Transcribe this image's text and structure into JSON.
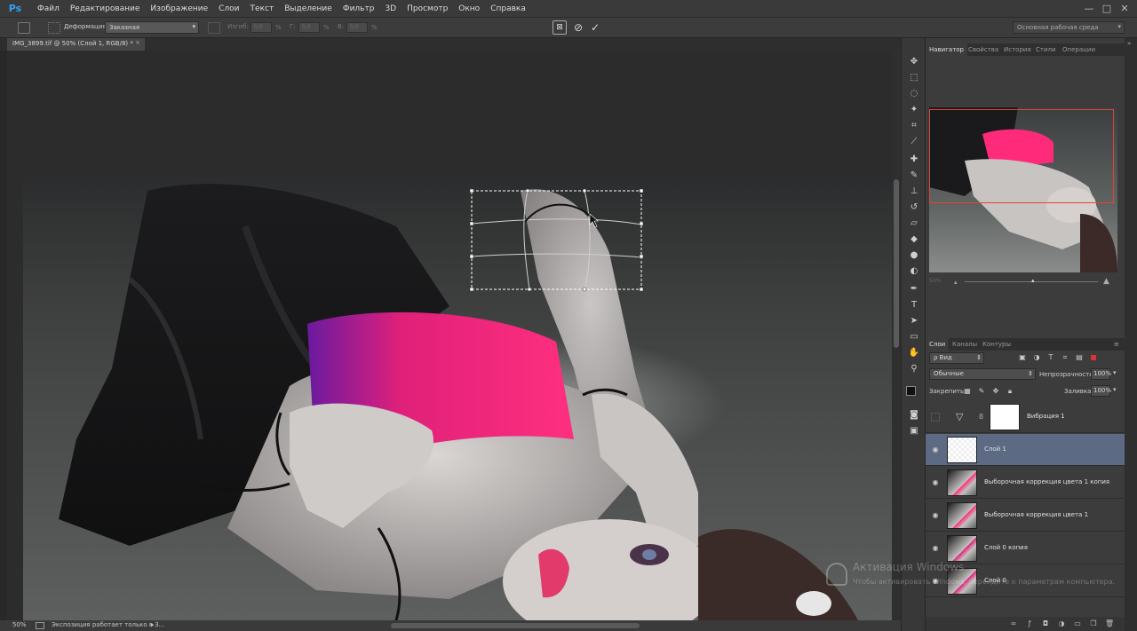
{
  "app": {
    "logo": "Ps"
  },
  "menu": [
    "Файл",
    "Редактирование",
    "Изображение",
    "Слои",
    "Текст",
    "Выделение",
    "Фильтр",
    "3D",
    "Просмотр",
    "Окно",
    "Справка"
  ],
  "window_controls": [
    "—",
    "□",
    "✕"
  ],
  "options": {
    "warp_label": "Деформация:",
    "warp_value": "Заказная",
    "bend_label": "Изгиб:",
    "bend_value": "0,0",
    "h_label": "Г:",
    "h_value": "0,0",
    "v_label": "В:",
    "v_value": "0,0",
    "percent": "%",
    "workspace": "Основная рабочая среда"
  },
  "document": {
    "tab_title": "IMG_3899.tif @ 50% (Слой 1, RGB/8) *",
    "tab_close": "×",
    "zoom": "50%",
    "status": "Экспозиция работает только в 3...",
    "status_arrow": "▸"
  },
  "panels": {
    "top_tabs": [
      "Навигатор",
      "Свойства",
      "История",
      "Стили",
      "Операции"
    ],
    "navigator_zoom": "50%",
    "layer_tabs": [
      "Слои",
      "Каналы",
      "Контуры"
    ]
  },
  "layers_panel": {
    "kind_filter": "ρ Вид",
    "blend_mode": "Обычные",
    "opacity_label": "Непрозрачность:",
    "opacity_value": "100%",
    "lock_label": "Закрепить:",
    "fill_label": "Заливка:",
    "fill_value": "100%"
  },
  "layers": [
    {
      "name": "Вибрация 1",
      "visible": false,
      "selected": false,
      "adjustment": true
    },
    {
      "name": "Слой 1",
      "visible": true,
      "selected": true,
      "adjustment": false
    },
    {
      "name": "Выборочная коррекция цвета 1 копия",
      "visible": true,
      "selected": false,
      "adjustment": false
    },
    {
      "name": "Выборочная коррекция цвета 1",
      "visible": true,
      "selected": false,
      "adjustment": false
    },
    {
      "name": "Слой 0 копия",
      "visible": true,
      "selected": false,
      "adjustment": false
    },
    {
      "name": "Слой 0",
      "visible": true,
      "selected": false,
      "adjustment": false
    }
  ],
  "watermark": {
    "title": "Активация Windows",
    "text": "Чтобы активировать Windows, перейдите к параметрам компьютера."
  },
  "colors": {
    "accent_layer": "#5c6a84",
    "navigator_box": "#e0443a",
    "ps_blue": "#2fa3f5",
    "top_pink": "#ff2a7a"
  }
}
